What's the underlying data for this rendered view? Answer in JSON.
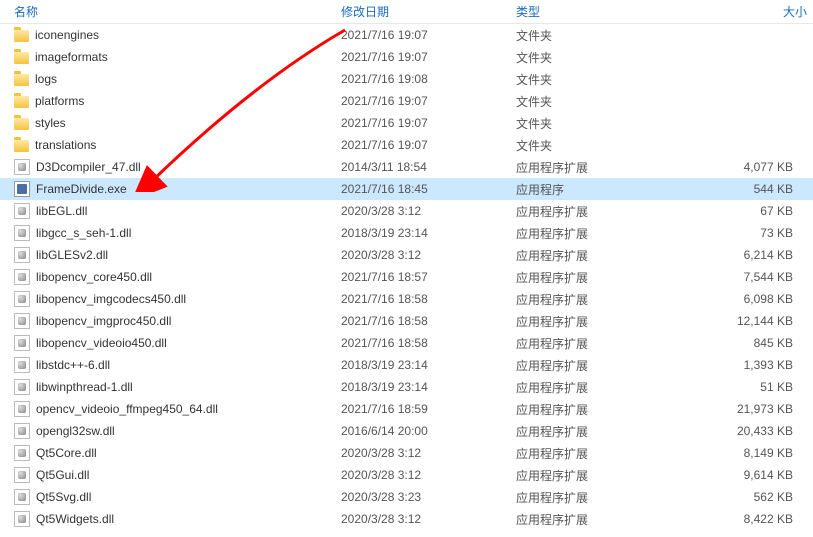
{
  "headers": {
    "name": "名称",
    "date": "修改日期",
    "type": "类型",
    "size": "大小"
  },
  "rows": [
    {
      "icon": "folder",
      "name": "iconengines",
      "date": "2021/7/16 19:07",
      "type": "文件夹",
      "size": "",
      "selected": false
    },
    {
      "icon": "folder",
      "name": "imageformats",
      "date": "2021/7/16 19:07",
      "type": "文件夹",
      "size": "",
      "selected": false
    },
    {
      "icon": "folder",
      "name": "logs",
      "date": "2021/7/16 19:08",
      "type": "文件夹",
      "size": "",
      "selected": false
    },
    {
      "icon": "folder",
      "name": "platforms",
      "date": "2021/7/16 19:07",
      "type": "文件夹",
      "size": "",
      "selected": false
    },
    {
      "icon": "folder",
      "name": "styles",
      "date": "2021/7/16 19:07",
      "type": "文件夹",
      "size": "",
      "selected": false
    },
    {
      "icon": "folder",
      "name": "translations",
      "date": "2021/7/16 19:07",
      "type": "文件夹",
      "size": "",
      "selected": false
    },
    {
      "icon": "dll",
      "name": "D3Dcompiler_47.dll",
      "date": "2014/3/11 18:54",
      "type": "应用程序扩展",
      "size": "4,077 KB",
      "selected": false
    },
    {
      "icon": "exe",
      "name": "FrameDivide.exe",
      "date": "2021/7/16 18:45",
      "type": "应用程序",
      "size": "544 KB",
      "selected": true
    },
    {
      "icon": "dll",
      "name": "libEGL.dll",
      "date": "2020/3/28 3:12",
      "type": "应用程序扩展",
      "size": "67 KB",
      "selected": false
    },
    {
      "icon": "dll",
      "name": "libgcc_s_seh-1.dll",
      "date": "2018/3/19 23:14",
      "type": "应用程序扩展",
      "size": "73 KB",
      "selected": false
    },
    {
      "icon": "dll",
      "name": "libGLESv2.dll",
      "date": "2020/3/28 3:12",
      "type": "应用程序扩展",
      "size": "6,214 KB",
      "selected": false
    },
    {
      "icon": "dll",
      "name": "libopencv_core450.dll",
      "date": "2021/7/16 18:57",
      "type": "应用程序扩展",
      "size": "7,544 KB",
      "selected": false
    },
    {
      "icon": "dll",
      "name": "libopencv_imgcodecs450.dll",
      "date": "2021/7/16 18:58",
      "type": "应用程序扩展",
      "size": "6,098 KB",
      "selected": false
    },
    {
      "icon": "dll",
      "name": "libopencv_imgproc450.dll",
      "date": "2021/7/16 18:58",
      "type": "应用程序扩展",
      "size": "12,144 KB",
      "selected": false
    },
    {
      "icon": "dll",
      "name": "libopencv_videoio450.dll",
      "date": "2021/7/16 18:58",
      "type": "应用程序扩展",
      "size": "845 KB",
      "selected": false
    },
    {
      "icon": "dll",
      "name": "libstdc++-6.dll",
      "date": "2018/3/19 23:14",
      "type": "应用程序扩展",
      "size": "1,393 KB",
      "selected": false
    },
    {
      "icon": "dll",
      "name": "libwinpthread-1.dll",
      "date": "2018/3/19 23:14",
      "type": "应用程序扩展",
      "size": "51 KB",
      "selected": false
    },
    {
      "icon": "dll",
      "name": "opencv_videoio_ffmpeg450_64.dll",
      "date": "2021/7/16 18:59",
      "type": "应用程序扩展",
      "size": "21,973 KB",
      "selected": false
    },
    {
      "icon": "dll",
      "name": "opengl32sw.dll",
      "date": "2016/6/14 20:00",
      "type": "应用程序扩展",
      "size": "20,433 KB",
      "selected": false
    },
    {
      "icon": "dll",
      "name": "Qt5Core.dll",
      "date": "2020/3/28 3:12",
      "type": "应用程序扩展",
      "size": "8,149 KB",
      "selected": false
    },
    {
      "icon": "dll",
      "name": "Qt5Gui.dll",
      "date": "2020/3/28 3:12",
      "type": "应用程序扩展",
      "size": "9,614 KB",
      "selected": false
    },
    {
      "icon": "dll",
      "name": "Qt5Svg.dll",
      "date": "2020/3/28 3:23",
      "type": "应用程序扩展",
      "size": "562 KB",
      "selected": false
    },
    {
      "icon": "dll",
      "name": "Qt5Widgets.dll",
      "date": "2020/3/28 3:12",
      "type": "应用程序扩展",
      "size": "8,422 KB",
      "selected": false
    }
  ]
}
